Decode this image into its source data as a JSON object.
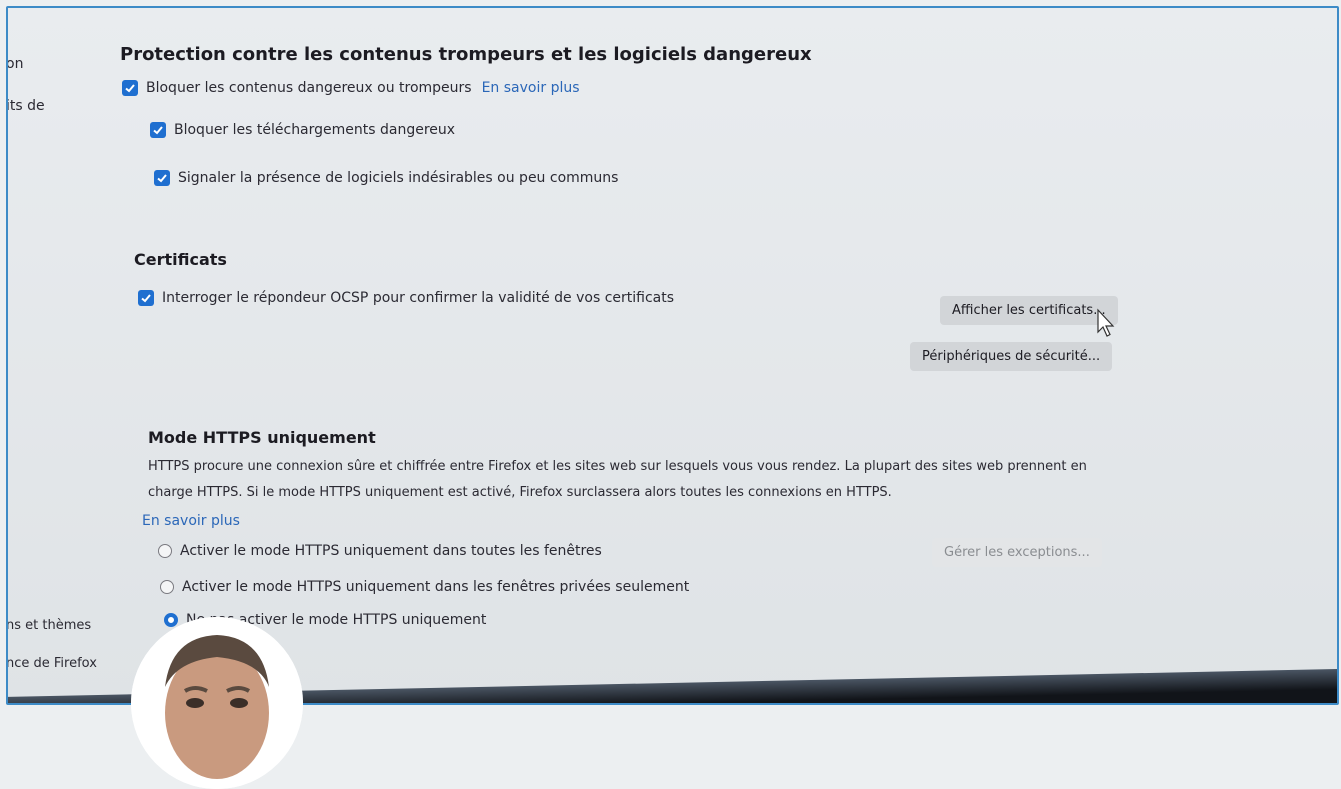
{
  "sidebar": {
    "items": [
      {
        "label": "on"
      },
      {
        "label": "its de"
      },
      {
        "label": "ns et thèmes"
      },
      {
        "label": "nce de Firefox"
      }
    ]
  },
  "protection": {
    "heading": "Protection contre les contenus trompeurs et les logiciels dangereux",
    "block_label": "Bloquer les contenus dangereux ou trompeurs",
    "learn_more": "En savoir plus",
    "block_downloads_label": "Bloquer les téléchargements dangereux",
    "warn_unwanted_label": "Signaler la présence de logiciels indésirables ou peu communs"
  },
  "certificates": {
    "heading": "Certificats",
    "ocsp_label": "Interroger le répondeur OCSP pour confirmer la validité de vos certificats",
    "view_button": "Afficher les certificats...",
    "devices_button": "Périphériques de sécurité..."
  },
  "https_only": {
    "heading": "Mode HTTPS uniquement",
    "description": "HTTPS procure une connexion sûre et chiffrée entre Firefox et les sites web sur lesquels vous vous rendez. La plupart des sites web prennent en charge HTTPS. Si le mode HTTPS uniquement est activé, Firefox surclassera alors toutes les connexions en HTTPS.",
    "learn_more": "En savoir plus",
    "options": [
      {
        "label": "Activer le mode HTTPS uniquement dans toutes les fenêtres",
        "selected": false
      },
      {
        "label": "Activer le mode HTTPS uniquement dans les fenêtres privées seulement",
        "selected": false
      },
      {
        "label": "Ne pas activer le mode HTTPS uniquement",
        "selected": true
      }
    ],
    "exceptions_button": "Gérer les exceptions..."
  },
  "colors": {
    "accent": "#1f6fd0",
    "link": "#2b67b8",
    "frame_border": "#3d8bc7"
  }
}
